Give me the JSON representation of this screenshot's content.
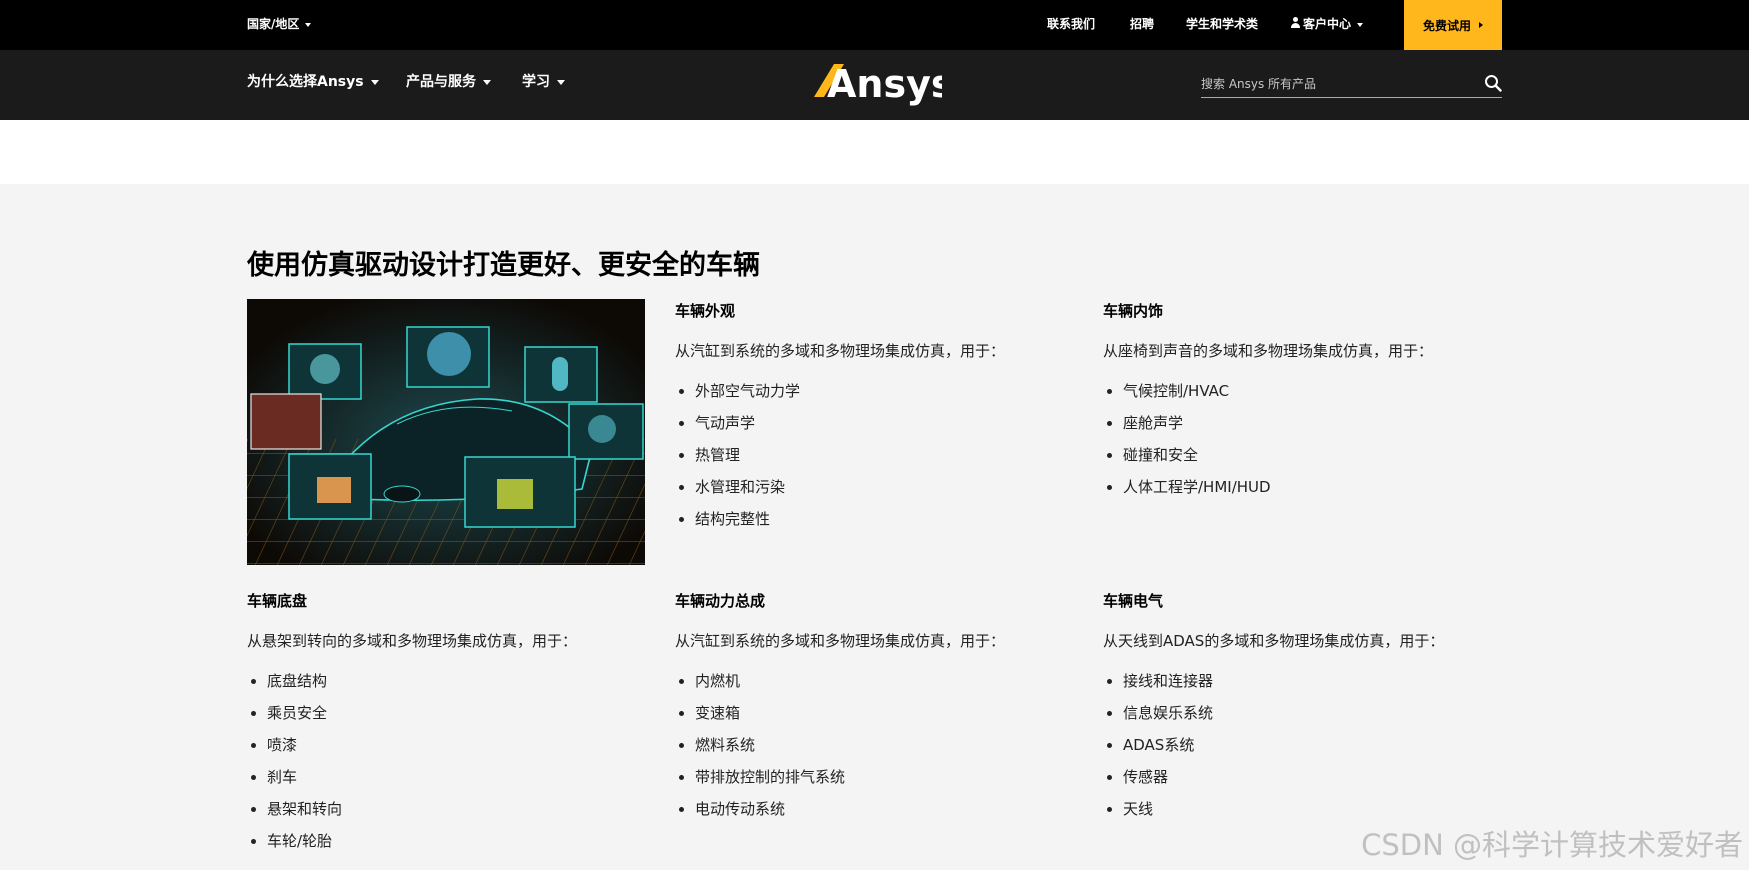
{
  "utility": {
    "region": "国家/地区",
    "links": [
      "联系我们",
      "招聘",
      "学生和学术类"
    ],
    "account": "客户中心",
    "trial": "免费试用"
  },
  "nav": {
    "items": [
      "为什么选择Ansys",
      "产品与服务",
      "学习"
    ],
    "logo": "Ansys"
  },
  "search": {
    "placeholder": "搜索 Ansys 所有产品"
  },
  "main": {
    "title": "使用仿真驱动设计打造更好、更安全的车辆",
    "sections": [
      {
        "title": "车辆外观",
        "desc": "从汽缸到系统的多域和多物理场集成仿真，用于：",
        "items": [
          "外部空气动力学",
          "气动声学",
          "热管理",
          "水管理和污染",
          "结构完整性"
        ]
      },
      {
        "title": "车辆内饰",
        "desc": "从座椅到声音的多域和多物理场集成仿真，用于：",
        "items": [
          "气候控制/HVAC",
          "座舱声学",
          "碰撞和安全",
          "人体工程学/HMI/HUD"
        ]
      },
      {
        "title": "车辆底盘",
        "desc": "从悬架到转向的多域和多物理场集成仿真，用于：",
        "items": [
          "底盘结构",
          "乘员安全",
          "喷漆",
          "刹车",
          "悬架和转向",
          "车轮/轮胎"
        ]
      },
      {
        "title": "车辆动力总成",
        "desc": "从汽缸到系统的多域和多物理场集成仿真，用于：",
        "items": [
          "内燃机",
          "变速箱",
          "燃料系统",
          "带排放控制的排气系统",
          "电动传动系统"
        ]
      },
      {
        "title": "车辆电气",
        "desc": "从天线到ADAS的多域和多物理场集成仿真，用于：",
        "items": [
          "接线和连接器",
          "信息娱乐系统",
          "ADAS系统",
          "传感器",
          "天线"
        ]
      }
    ]
  },
  "watermark": "CSDN @科学计算技术爱好者",
  "colors": {
    "accent": "#ffb71b",
    "topbar": "#000000",
    "navbar": "#1b1b1b",
    "content_bg": "#f4f4f4"
  }
}
